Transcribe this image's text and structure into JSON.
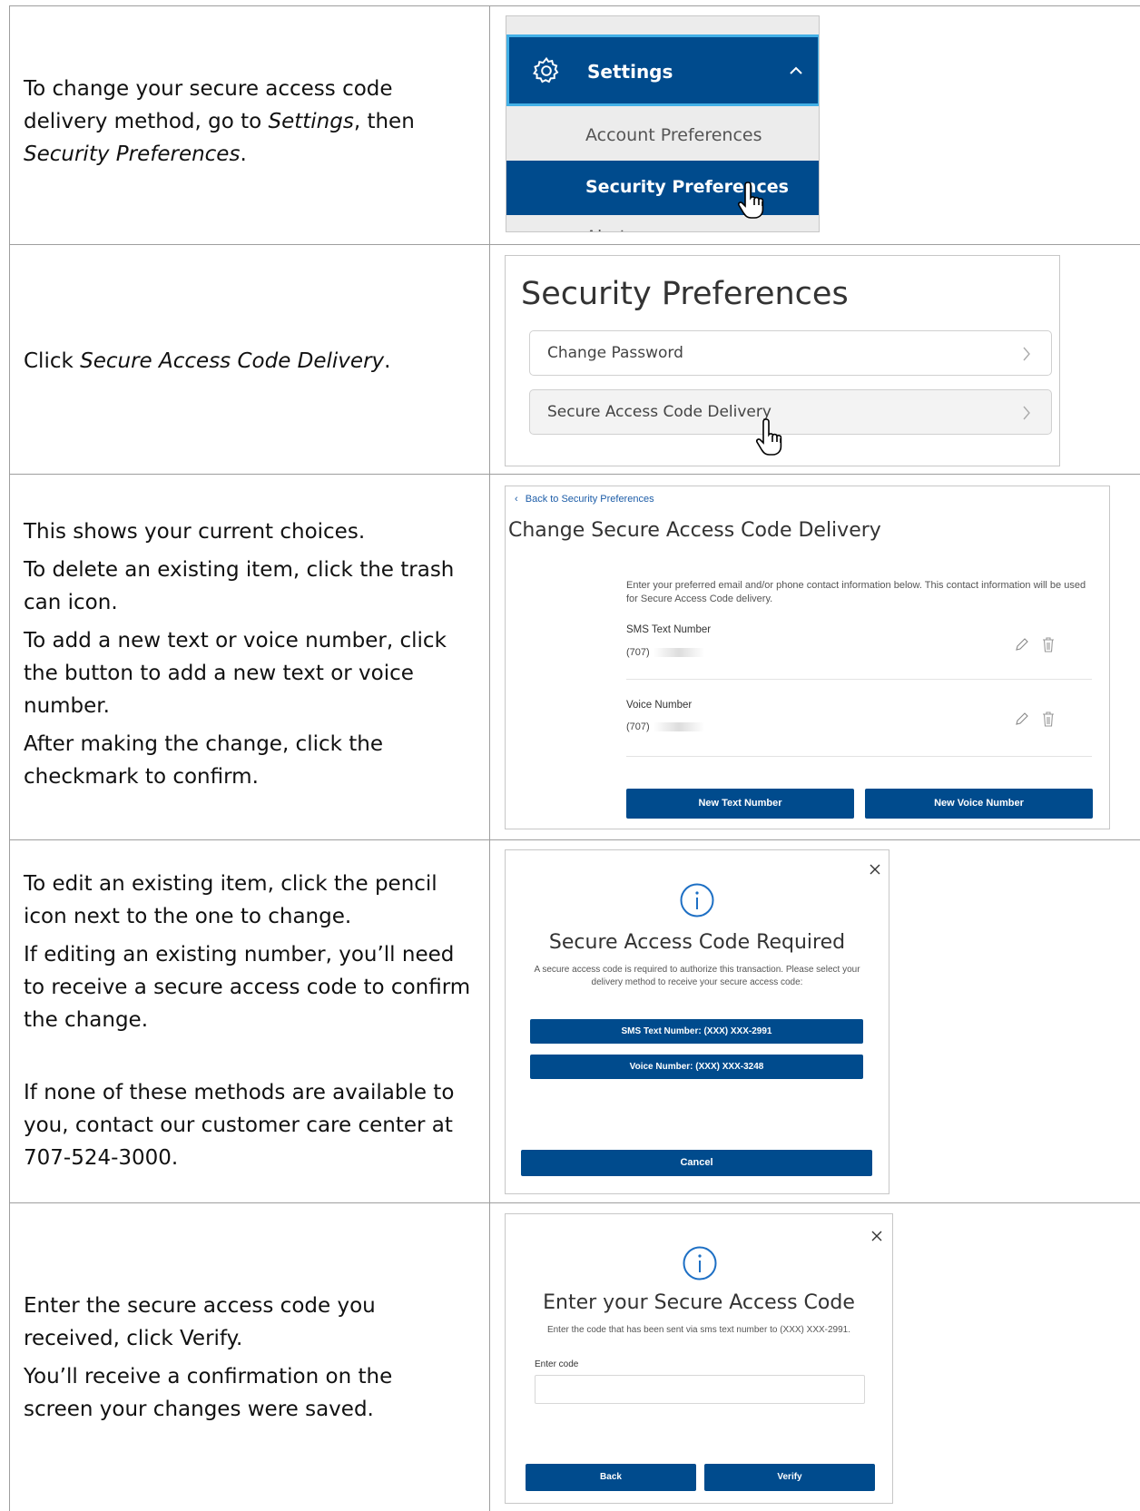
{
  "steps": [
    {
      "text_parts": [
        {
          "t": "To change your secure access code delivery method, go to "
        },
        {
          "t": "Settings",
          "i": true
        },
        {
          "t": ", then "
        },
        {
          "t": "Security Preferences",
          "i": true
        },
        {
          "t": "."
        }
      ]
    },
    {
      "text_parts": [
        {
          "t": "Click "
        },
        {
          "t": "Secure Access Code Delivery",
          "i": true
        },
        {
          "t": "."
        }
      ]
    },
    {
      "paragraphs": [
        "This shows your current choices.",
        "To delete an existing item, click the trash can icon.",
        "To add a new text or voice number, click the button to add a new text or voice number.",
        "After making the change, click the checkmark to confirm."
      ]
    },
    {
      "paragraphs": [
        "To edit an existing item, click the pencil icon next to the one to change.",
        "If editing an existing number, you’ll need to receive a secure access code to confirm the change.",
        "If none of these methods are available to you, contact our customer care center at 707-524-3000."
      ]
    },
    {
      "paragraphs": [
        "Enter the secure access code you received, click Verify.",
        "You’ll receive a confirmation on the screen your changes were saved."
      ]
    }
  ],
  "settings_menu": {
    "header": "Settings",
    "items": [
      "Account Preferences",
      "Security Preferences",
      "Alerts"
    ],
    "active_color": "#004b8d"
  },
  "security_prefs": {
    "title": "Security Preferences",
    "rows": [
      "Change Password",
      "Secure Access Code Delivery"
    ]
  },
  "sac_delivery": {
    "back_link": "Back to Security Preferences",
    "title": "Change Secure Access Code Delivery",
    "intro": "Enter your preferred email and/or phone contact information below. This contact information will be used for Secure Access Code delivery.",
    "items": [
      {
        "label": "SMS Text Number",
        "value": "(707)"
      },
      {
        "label": "Voice Number",
        "value": "(707)"
      }
    ],
    "buttons": [
      "New Text Number",
      "New Voice Number"
    ]
  },
  "sac_required": {
    "title": "Secure Access Code Required",
    "message": "A secure access code is required to authorize this transaction. Please select your delivery method to receive your secure access code:",
    "options": [
      "SMS Text Number: (XXX) XXX-2991",
      "Voice Number: (XXX) XXX-3248"
    ],
    "cancel": "Cancel"
  },
  "enter_code": {
    "title": "Enter your Secure Access Code",
    "message": "Enter the code that has been sent via sms text number to (XXX) XXX-2991.",
    "field_label": "Enter code",
    "field_value": "",
    "back": "Back",
    "verify": "Verify"
  }
}
